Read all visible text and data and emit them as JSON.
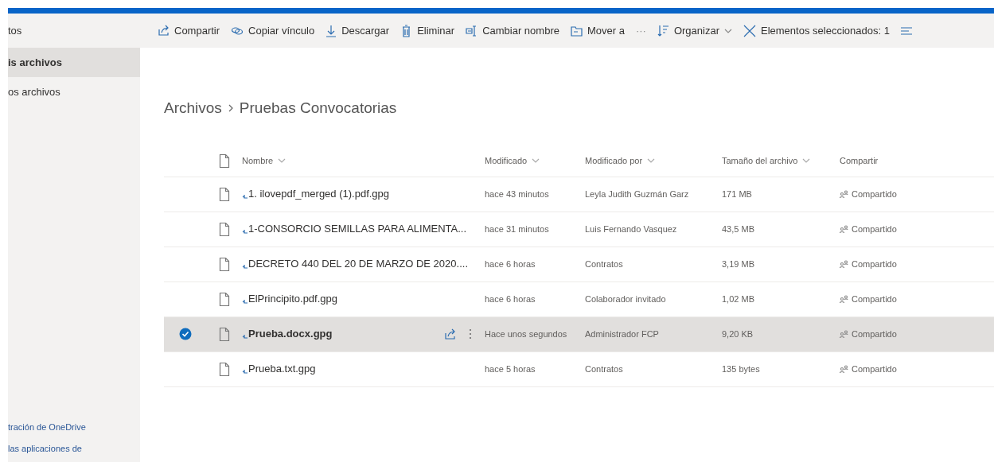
{
  "sidebar": {
    "items": [
      {
        "label": "tos",
        "selected": false
      },
      {
        "label": "is archivos",
        "selected": true
      },
      {
        "label": "os archivos",
        "selected": false
      }
    ],
    "footer_links": [
      "tración de OneDrive",
      "las aplicaciones de"
    ]
  },
  "toolbar": {
    "actions": [
      {
        "label": "Compartir"
      },
      {
        "label": "Copiar vínculo"
      },
      {
        "label": "Descargar"
      },
      {
        "label": "Eliminar"
      },
      {
        "label": "Cambiar nombre"
      },
      {
        "label": "Mover a"
      },
      {
        "label": "···"
      },
      {
        "label": "Organizar",
        "dropdown": true
      }
    ],
    "selection": "Elementos seleccionados: 1"
  },
  "breadcrumb": [
    "Archivos",
    "Pruebas Convocatorias"
  ],
  "table": {
    "columns": [
      {
        "label": "Nombre",
        "sortable": true
      },
      {
        "label": "Modificado",
        "sortable": true
      },
      {
        "label": "Modificado por",
        "sortable": true
      },
      {
        "label": "Tamaño del archivo",
        "sortable": true
      },
      {
        "label": "Compartir",
        "sortable": false
      }
    ],
    "rows": [
      {
        "name": "1. ilovepdf_merged (1).pdf.gpg",
        "modified": "hace 43 minutos",
        "modified_by": "Leyla Judith Guzmán Garz",
        "size": "171 MB",
        "sharing": "Compartido",
        "selected": false
      },
      {
        "name": "1-CONSORCIO SEMILLAS PARA ALIMENTA...",
        "modified": "hace 31 minutos",
        "modified_by": "Luis Fernando Vasquez",
        "size": "43,5 MB",
        "sharing": "Compartido",
        "selected": false
      },
      {
        "name": "DECRETO 440 DEL 20 DE MARZO DE 2020....",
        "modified": "hace 6 horas",
        "modified_by": "Contratos",
        "size": "3,19 MB",
        "sharing": "Compartido",
        "selected": false
      },
      {
        "name": "ElPrincipito.pdf.gpg",
        "modified": "hace 6 horas",
        "modified_by": "Colaborador invitado",
        "size": "1,02 MB",
        "sharing": "Compartido",
        "selected": false
      },
      {
        "name": "Prueba.docx.gpg",
        "modified": "Hace unos segundos",
        "modified_by": "Administrador FCP",
        "size": "9,20 KB",
        "sharing": "Compartido",
        "selected": true
      },
      {
        "name": "Prueba.txt.gpg",
        "modified": "hace 5 horas",
        "modified_by": "Contratos",
        "size": "135 bytes",
        "sharing": "Compartido",
        "selected": false
      }
    ]
  }
}
